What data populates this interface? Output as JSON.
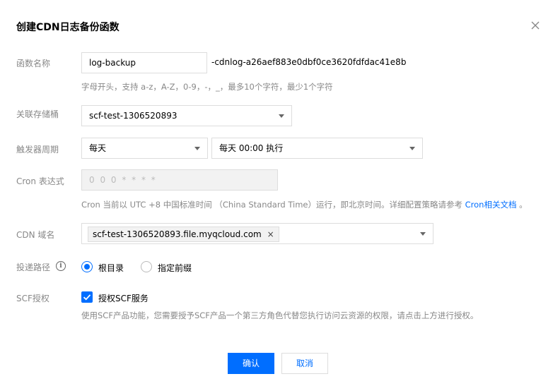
{
  "dialog": {
    "title": "创建CDN日志备份函数",
    "close_icon": "close-icon"
  },
  "function_name": {
    "label": "函数名称",
    "value": "log-backup",
    "suffix": "-cdnlog-a26aef883e0dbf0ce3620fdfdac41e8b",
    "hint": "字母开头，支持 a-z，A-Z，0-9，-，_，最多10个字符，最少1个字符"
  },
  "bucket": {
    "label": "关联存储桶",
    "value": "scf-test-1306520893"
  },
  "trigger": {
    "label": "触发器周期",
    "period": "每天",
    "time": "每天 00:00 执行"
  },
  "cron": {
    "label": "Cron 表达式",
    "value": "0 0 0 * * * *",
    "hint_prefix": "Cron 当前以 UTC +8 中国标准时间 （China Standard Time）运行，即北京时间。详细配置策略请参考",
    "hint_link": "Cron相关文档",
    "hint_suffix": "。"
  },
  "cdn_domain": {
    "label": "CDN 域名",
    "tag": "scf-test-1306520893.file.myqcloud.com",
    "tag_remove": "×"
  },
  "delivery_path": {
    "label": "投递路径",
    "info_icon": "info-icon",
    "options": [
      "根目录",
      "指定前缀"
    ],
    "selected": "根目录"
  },
  "scf_auth": {
    "label": "SCF授权",
    "checkbox_label": "授权SCF服务",
    "checked": true,
    "hint": "使用SCF产品功能，您需要授予SCF产品一个第三方角色代替您执行访问云资源的权限，请点击上方进行授权。"
  },
  "buttons": {
    "confirm": "确认",
    "cancel": "取消"
  },
  "colors": {
    "accent": "#006eff",
    "label": "#888888",
    "border": "#dddddd"
  }
}
